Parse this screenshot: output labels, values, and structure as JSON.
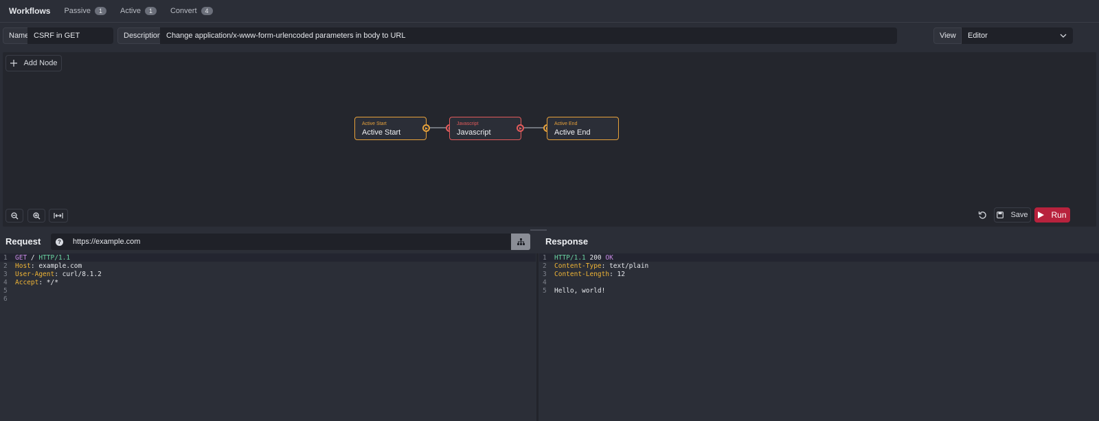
{
  "app": {
    "title": "Workflows"
  },
  "tabs": [
    {
      "label": "Passive",
      "count": "1"
    },
    {
      "label": "Active",
      "count": "1"
    },
    {
      "label": "Convert",
      "count": "4"
    }
  ],
  "details": {
    "name_label": "Name",
    "name_value": "CSRF in GET",
    "description_label": "Description",
    "description_value": "Change application/x-www-form-urlencoded parameters in body to URL",
    "view_label": "View",
    "view_value": "Editor"
  },
  "canvas": {
    "add_node_label": "Add Node",
    "nodes": [
      {
        "kind": "Active Start",
        "title": "Active Start",
        "color": "#e8a23b"
      },
      {
        "kind": "Javascript",
        "title": "Javascript",
        "color": "#e55b5b"
      },
      {
        "kind": "Active End",
        "title": "Active End",
        "color": "#e8a23b"
      }
    ],
    "save_label": "Save",
    "run_label": "Run",
    "accent": "#b8223d"
  },
  "request": {
    "title": "Request",
    "url": "https://example.com",
    "lines": [
      {
        "n": "1",
        "method": "GET",
        "path": " / ",
        "proto": "HTTP/1.1"
      },
      {
        "n": "2",
        "key": "Host",
        "value": ": example.com"
      },
      {
        "n": "3",
        "key": "User-Agent",
        "value": ": curl/8.1.2"
      },
      {
        "n": "4",
        "key": "Accept",
        "value": ": */*"
      },
      {
        "n": "5"
      },
      {
        "n": "6"
      }
    ]
  },
  "response": {
    "title": "Response",
    "lines": [
      {
        "n": "1",
        "proto": "HTTP/1.1",
        "status": " 200 ",
        "reason": "OK"
      },
      {
        "n": "2",
        "key": "Content-Type",
        "value": ": text/plain"
      },
      {
        "n": "3",
        "key": "Content-Length",
        "value": ": 12"
      },
      {
        "n": "4"
      },
      {
        "n": "5",
        "body": "Hello, world!"
      }
    ]
  }
}
